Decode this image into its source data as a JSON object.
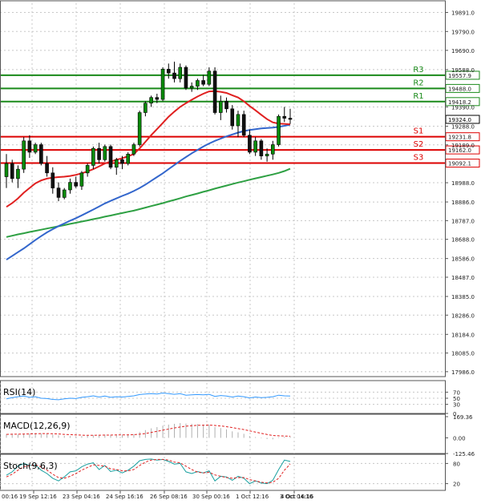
{
  "chart_data": {
    "type": "candlestick",
    "price_axis_labels": [
      "19891.0",
      "19790.0",
      "19690.0",
      "19588.0",
      "19390.0",
      "19288.0",
      "19189.0",
      "18988.0",
      "18886.0",
      "18787.0",
      "18688.0",
      "18586.0",
      "18487.0",
      "18385.0",
      "18286.0",
      "18184.0",
      "18085.0",
      "17986.0"
    ],
    "ylim": [
      17960,
      19940
    ],
    "x_labels": [
      "00:16",
      "19 Sep 12:16",
      "23 Sep 04:16",
      "24 Sep 16:16",
      "26 Sep 08:16",
      "30 Sep 00:16",
      "1 Oct 12:16",
      "3 Oct 04:16",
      "4 Oct 16:16"
    ],
    "levels": [
      {
        "label": "R3",
        "value": 19557.9,
        "tag": "19557.9",
        "color": "#1a8a1a"
      },
      {
        "label": "R2",
        "value": 19488.0,
        "tag": "19488.0",
        "color": "#1a8a1a"
      },
      {
        "label": "R1",
        "value": 19418.2,
        "tag": "19418.2",
        "color": "#1a8a1a"
      },
      {
        "label": "S1",
        "value": 19231.8,
        "tag": "19231.8",
        "color": "#dd0000"
      },
      {
        "label": "S2",
        "value": 19162.0,
        "tag": "19162.0",
        "color": "#dd0000"
      },
      {
        "label": "S3",
        "value": 19092.1,
        "tag": "19092.1",
        "color": "#dd0000"
      }
    ],
    "current_price": {
      "value": 19324.0,
      "tag": "19324.0"
    },
    "candles": [
      [
        19020,
        19140,
        18960,
        19090
      ],
      [
        19090,
        19110,
        18990,
        19010
      ],
      [
        19010,
        19080,
        18960,
        19060
      ],
      [
        19060,
        19230,
        19040,
        19210
      ],
      [
        19210,
        19240,
        19120,
        19150
      ],
      [
        19150,
        19200,
        19140,
        19190
      ],
      [
        19190,
        19200,
        19080,
        19090
      ],
      [
        19090,
        19130,
        19020,
        19040
      ],
      [
        19040,
        19070,
        18930,
        18960
      ],
      [
        18960,
        18990,
        18890,
        18910
      ],
      [
        18910,
        18960,
        18900,
        18950
      ],
      [
        18950,
        19010,
        18930,
        18990
      ],
      [
        18990,
        19020,
        18960,
        18970
      ],
      [
        18970,
        19050,
        18950,
        19040
      ],
      [
        19040,
        19090,
        19020,
        19080
      ],
      [
        19080,
        19180,
        19060,
        19170
      ],
      [
        19170,
        19200,
        19090,
        19110
      ],
      [
        19110,
        19190,
        19100,
        19180
      ],
      [
        19180,
        19190,
        19060,
        19070
      ],
      [
        19070,
        19120,
        19030,
        19110
      ],
      [
        19110,
        19130,
        19060,
        19090
      ],
      [
        19090,
        19150,
        19080,
        19140
      ],
      [
        19140,
        19200,
        19130,
        19190
      ],
      [
        19190,
        19370,
        19180,
        19360
      ],
      [
        19360,
        19420,
        19340,
        19410
      ],
      [
        19410,
        19450,
        19390,
        19440
      ],
      [
        19440,
        19460,
        19410,
        19430
      ],
      [
        19430,
        19600,
        19420,
        19590
      ],
      [
        19590,
        19620,
        19540,
        19570
      ],
      [
        19570,
        19630,
        19520,
        19540
      ],
      [
        19540,
        19620,
        19520,
        19600
      ],
      [
        19600,
        19610,
        19480,
        19490
      ],
      [
        19490,
        19520,
        19470,
        19500
      ],
      [
        19500,
        19540,
        19480,
        19530
      ],
      [
        19530,
        19560,
        19500,
        19510
      ],
      [
        19510,
        19600,
        19500,
        19580
      ],
      [
        19580,
        19600,
        19350,
        19360
      ],
      [
        19360,
        19450,
        19320,
        19420
      ],
      [
        19420,
        19440,
        19360,
        19380
      ],
      [
        19380,
        19400,
        19270,
        19290
      ],
      [
        19290,
        19370,
        19230,
        19350
      ],
      [
        19350,
        19370,
        19230,
        19240
      ],
      [
        19240,
        19270,
        19140,
        19150
      ],
      [
        19150,
        19230,
        19130,
        19210
      ],
      [
        19210,
        19220,
        19110,
        19130
      ],
      [
        19130,
        19170,
        19100,
        19140
      ],
      [
        19140,
        19210,
        19110,
        19190
      ],
      [
        19190,
        19350,
        19180,
        19340
      ],
      [
        19340,
        19390,
        19310,
        19330
      ],
      [
        19330,
        19380,
        19300,
        19324
      ]
    ],
    "ma_fast": [
      18860,
      18880,
      18905,
      18935,
      18960,
      18985,
      19000,
      19010,
      19015,
      19018,
      19020,
      19024,
      19030,
      19038,
      19048,
      19060,
      19075,
      19090,
      19100,
      19110,
      19118,
      19128,
      19140,
      19170,
      19205,
      19240,
      19272,
      19305,
      19338,
      19365,
      19390,
      19410,
      19428,
      19445,
      19460,
      19472,
      19474,
      19470,
      19464,
      19452,
      19440,
      19420,
      19395,
      19372,
      19348,
      19325,
      19308,
      19302,
      19300,
      19298
    ],
    "ma_mid": [
      18580,
      18600,
      18620,
      18640,
      18662,
      18684,
      18705,
      18725,
      18742,
      18758,
      18772,
      18787,
      18800,
      18815,
      18830,
      18846,
      18862,
      18878,
      18892,
      18905,
      18918,
      18930,
      18944,
      18960,
      18978,
      18998,
      19018,
      19038,
      19060,
      19082,
      19104,
      19124,
      19144,
      19162,
      19180,
      19196,
      19210,
      19222,
      19234,
      19244,
      19254,
      19262,
      19268,
      19272,
      19276,
      19278,
      19280,
      19284,
      19290,
      19296
    ],
    "ma_slow": [
      18700,
      18707,
      18714,
      18720,
      18727,
      18733,
      18739,
      18745,
      18751,
      18757,
      18763,
      18770,
      18776,
      18782,
      18788,
      18795,
      18801,
      18808,
      18814,
      18821,
      18827,
      18834,
      18840,
      18848,
      18856,
      18864,
      18872,
      18880,
      18889,
      18897,
      18906,
      18915,
      18923,
      18931,
      18940,
      18948,
      18957,
      18965,
      18973,
      18981,
      18989,
      18996,
      19004,
      19011,
      19018,
      19025,
      19032,
      19040,
      19050,
      19062
    ],
    "series": [
      {
        "name": "RSI(14)",
        "axis_labels": [
          "70",
          "50",
          "30",
          "0"
        ],
        "ylim": [
          0,
          100
        ],
        "levels": [
          30,
          50,
          70
        ],
        "values": [
          48,
          52,
          55,
          57,
          53,
          55,
          50,
          49,
          46,
          45,
          48,
          50,
          49,
          53,
          55,
          58,
          54,
          57,
          53,
          55,
          54,
          56,
          58,
          62,
          64,
          65,
          64,
          67,
          65,
          63,
          65,
          60,
          61,
          62,
          61,
          63,
          56,
          59,
          57,
          54,
          57,
          55,
          51,
          54,
          52,
          53,
          55,
          60,
          58,
          57
        ]
      },
      {
        "name": "MACD(12,26,9)",
        "axis_labels": [
          "169.36",
          "0.00",
          "-125.46"
        ],
        "ylim": [
          -125.46,
          169.36
        ],
        "histogram": [
          30,
          28,
          28,
          34,
          35,
          38,
          36,
          32,
          26,
          20,
          16,
          14,
          12,
          14,
          17,
          22,
          22,
          26,
          24,
          25,
          25,
          27,
          30,
          46,
          62,
          76,
          86,
          98,
          106,
          112,
          118,
          114,
          112,
          110,
          106,
          106,
          86,
          78,
          68,
          52,
          44,
          32,
          14,
          6,
          -4,
          -10,
          -12,
          4,
          8,
          10
        ],
        "signal": [
          28,
          29,
          29,
          30,
          31,
          33,
          34,
          34,
          33,
          31,
          28,
          26,
          23,
          21,
          20,
          20,
          21,
          22,
          22,
          23,
          23,
          24,
          25,
          29,
          35,
          43,
          52,
          61,
          70,
          79,
          87,
          93,
          97,
          100,
          101,
          102,
          99,
          95,
          89,
          82,
          74,
          66,
          56,
          46,
          36,
          27,
          19,
          16,
          14,
          13
        ]
      },
      {
        "name": "Stoch(9,6,3)",
        "axis_labels": [
          "80",
          "20"
        ],
        "ylim": [
          0,
          100
        ],
        "levels": [
          20,
          80
        ],
        "main": [
          45,
          55,
          72,
          80,
          74,
          76,
          60,
          50,
          36,
          28,
          40,
          55,
          58,
          70,
          78,
          82,
          62,
          74,
          56,
          60,
          52,
          60,
          72,
          88,
          92,
          93,
          90,
          92,
          86,
          78,
          80,
          55,
          50,
          56,
          52,
          58,
          28,
          42,
          40,
          30,
          42,
          36,
          20,
          28,
          22,
          20,
          30,
          62,
          90,
          86
        ],
        "signal": [
          40,
          48,
          60,
          70,
          74,
          76,
          70,
          60,
          48,
          38,
          36,
          42,
          50,
          60,
          68,
          76,
          74,
          72,
          64,
          62,
          58,
          58,
          62,
          74,
          84,
          90,
          92,
          92,
          90,
          84,
          82,
          72,
          62,
          54,
          52,
          54,
          46,
          42,
          38,
          36,
          38,
          38,
          32,
          28,
          24,
          22,
          24,
          36,
          60,
          78
        ]
      }
    ]
  }
}
